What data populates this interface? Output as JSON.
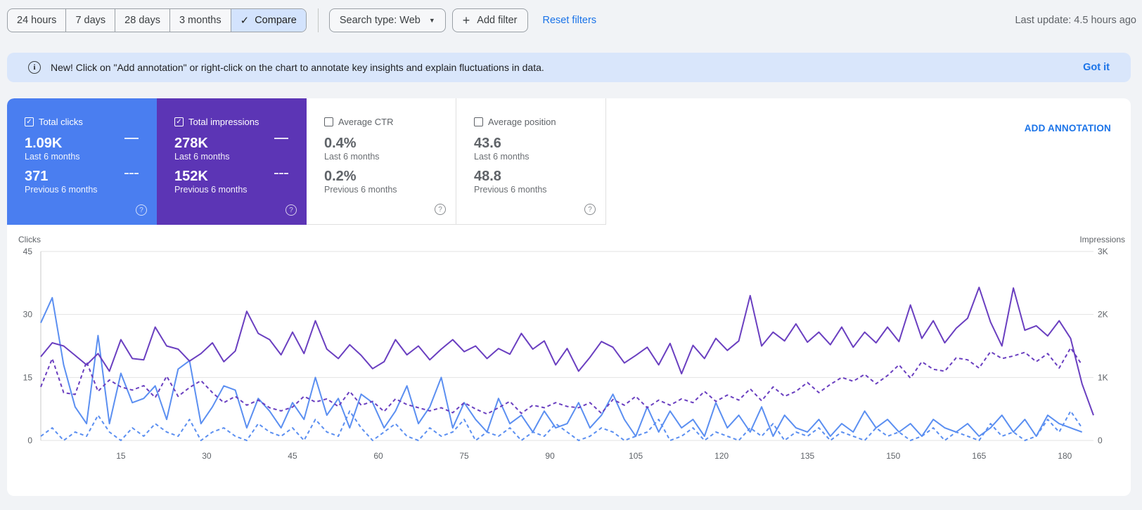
{
  "toolbar": {
    "ranges": [
      "24 hours",
      "7 days",
      "28 days",
      "3 months"
    ],
    "compare_label": "Compare",
    "search_type_label": "Search type: Web",
    "add_filter_label": "Add filter",
    "reset_filters_label": "Reset filters",
    "last_update": "Last update: 4.5 hours ago"
  },
  "banner": {
    "text": "New! Click on \"Add annotation\" or right-click on the chart to annotate key insights and explain fluctuations in data.",
    "action": "Got it"
  },
  "metrics": [
    {
      "label": "Total clicks",
      "checked": true,
      "current": "1.09K",
      "current_period": "Last 6 months",
      "previous": "371",
      "previous_period": "Previous 6 months",
      "color": "#4a7ef0"
    },
    {
      "label": "Total impressions",
      "checked": true,
      "current": "278K",
      "current_period": "Last 6 months",
      "previous": "152K",
      "previous_period": "Previous 6 months",
      "color": "#5c35b5"
    },
    {
      "label": "Average CTR",
      "checked": false,
      "current": "0.4%",
      "current_period": "Last 6 months",
      "previous": "0.2%",
      "previous_period": "Previous 6 months"
    },
    {
      "label": "Average position",
      "checked": false,
      "current": "43.6",
      "current_period": "Last 6 months",
      "previous": "48.8",
      "previous_period": "Previous 6 months"
    }
  ],
  "add_annotation_label": "ADD ANNOTATION",
  "chart_data": {
    "type": "line",
    "left_axis": {
      "label": "Clicks",
      "ticks": [
        0,
        15,
        30,
        45
      ],
      "ylim": [
        0,
        45
      ]
    },
    "right_axis": {
      "label": "Impressions",
      "ticks": [
        "0",
        "1K",
        "2K",
        "3K"
      ],
      "ylim": [
        0,
        3000
      ]
    },
    "x_ticks": [
      15,
      30,
      45,
      60,
      75,
      90,
      105,
      120,
      135,
      150,
      165,
      180
    ],
    "xlim": [
      1,
      185
    ],
    "grid": true,
    "series": [
      {
        "name": "Total clicks",
        "period": "Last 6 months",
        "axis": "left",
        "style": "solid",
        "color": "#5b8ff1",
        "x": [
          1,
          3,
          5,
          7,
          9,
          11,
          13,
          15,
          17,
          19,
          21,
          23,
          25,
          27,
          29,
          31,
          33,
          35,
          37,
          39,
          41,
          43,
          45,
          47,
          49,
          51,
          53,
          55,
          57,
          59,
          61,
          63,
          65,
          67,
          69,
          71,
          73,
          75,
          77,
          79,
          81,
          83,
          85,
          87,
          89,
          91,
          93,
          95,
          97,
          99,
          101,
          103,
          105,
          107,
          109,
          111,
          113,
          115,
          117,
          119,
          121,
          123,
          125,
          127,
          129,
          131,
          133,
          135,
          137,
          139,
          141,
          143,
          145,
          147,
          149,
          151,
          153,
          155,
          157,
          159,
          161,
          163,
          165,
          167,
          169,
          171,
          173,
          175,
          177,
          179,
          181,
          183
        ],
        "values": [
          28,
          34,
          18,
          8,
          4,
          25,
          4,
          16,
          9,
          10,
          13,
          5,
          17,
          19,
          4,
          8,
          13,
          12,
          3,
          10,
          7,
          3,
          9,
          5,
          15,
          6,
          10,
          3,
          11,
          9,
          3,
          7,
          13,
          4,
          8,
          15,
          3,
          9,
          5,
          2,
          10,
          4,
          6,
          2,
          7,
          3,
          4,
          9,
          3,
          6,
          11,
          5,
          1,
          8,
          2,
          7,
          3,
          5,
          1,
          9,
          3,
          6,
          2,
          8,
          1,
          6,
          3,
          2,
          5,
          1,
          4,
          2,
          7,
          3,
          5,
          2,
          4,
          1,
          5,
          3,
          2,
          4,
          1,
          3,
          6,
          2,
          5,
          1,
          6,
          4,
          3,
          2
        ]
      },
      {
        "name": "Total clicks",
        "period": "Previous 6 months",
        "axis": "left",
        "style": "dashed",
        "color": "#5b8ff1",
        "x": [
          1,
          3,
          5,
          7,
          9,
          11,
          13,
          15,
          17,
          19,
          21,
          23,
          25,
          27,
          29,
          31,
          33,
          35,
          37,
          39,
          41,
          43,
          45,
          47,
          49,
          51,
          53,
          55,
          57,
          59,
          61,
          63,
          65,
          67,
          69,
          71,
          73,
          75,
          77,
          79,
          81,
          83,
          85,
          87,
          89,
          91,
          93,
          95,
          97,
          99,
          101,
          103,
          105,
          107,
          109,
          111,
          113,
          115,
          117,
          119,
          121,
          123,
          125,
          127,
          129,
          131,
          133,
          135,
          137,
          139,
          141,
          143,
          145,
          147,
          149,
          151,
          153,
          155,
          157,
          159,
          161,
          163,
          165,
          167,
          169,
          171,
          173,
          175,
          177,
          179,
          181,
          183
        ],
        "values": [
          1,
          3,
          0,
          2,
          1,
          6,
          2,
          0,
          3,
          1,
          4,
          2,
          1,
          5,
          0,
          2,
          3,
          1,
          0,
          4,
          2,
          1,
          3,
          0,
          5,
          2,
          1,
          7,
          3,
          0,
          2,
          4,
          1,
          0,
          3,
          1,
          2,
          5,
          0,
          2,
          1,
          3,
          0,
          2,
          1,
          4,
          2,
          0,
          1,
          3,
          2,
          0,
          1,
          2,
          5,
          0,
          1,
          3,
          0,
          2,
          1,
          0,
          3,
          1,
          4,
          0,
          2,
          1,
          3,
          0,
          2,
          1,
          0,
          3,
          1,
          2,
          0,
          1,
          3,
          0,
          2,
          1,
          0,
          4,
          1,
          2,
          0,
          1,
          5,
          2,
          7,
          3
        ]
      },
      {
        "name": "Total impressions",
        "period": "Last 6 months",
        "axis": "right",
        "style": "solid",
        "color": "#6a3fc0",
        "x": [
          1,
          3,
          5,
          7,
          9,
          11,
          13,
          15,
          17,
          19,
          21,
          23,
          25,
          27,
          29,
          31,
          33,
          35,
          37,
          39,
          41,
          43,
          45,
          47,
          49,
          51,
          53,
          55,
          57,
          59,
          61,
          63,
          65,
          67,
          69,
          71,
          73,
          75,
          77,
          79,
          81,
          83,
          85,
          87,
          89,
          91,
          93,
          95,
          97,
          99,
          101,
          103,
          105,
          107,
          109,
          111,
          113,
          115,
          117,
          119,
          121,
          123,
          125,
          127,
          129,
          131,
          133,
          135,
          137,
          139,
          141,
          143,
          145,
          147,
          149,
          151,
          153,
          155,
          157,
          159,
          161,
          163,
          165,
          167,
          169,
          171,
          173,
          175,
          177,
          179,
          181,
          183,
          185
        ],
        "values": [
          1330,
          1550,
          1500,
          1350,
          1200,
          1380,
          1100,
          1600,
          1300,
          1280,
          1800,
          1500,
          1450,
          1260,
          1380,
          1550,
          1250,
          1420,
          2050,
          1700,
          1600,
          1360,
          1720,
          1380,
          1900,
          1450,
          1300,
          1520,
          1350,
          1140,
          1250,
          1600,
          1360,
          1500,
          1280,
          1450,
          1600,
          1410,
          1500,
          1300,
          1460,
          1370,
          1700,
          1450,
          1580,
          1200,
          1460,
          1100,
          1320,
          1570,
          1480,
          1230,
          1350,
          1480,
          1200,
          1540,
          1060,
          1510,
          1300,
          1620,
          1430,
          1580,
          2300,
          1500,
          1720,
          1580,
          1850,
          1560,
          1720,
          1520,
          1800,
          1480,
          1720,
          1550,
          1800,
          1570,
          2150,
          1620,
          1900,
          1550,
          1780,
          1940,
          2430,
          1880,
          1500,
          2420,
          1750,
          1820,
          1660,
          1900,
          1620,
          900,
          400
        ]
      },
      {
        "name": "Total impressions",
        "period": "Previous 6 months",
        "axis": "right",
        "style": "dashed",
        "color": "#6a3fc0",
        "x": [
          1,
          3,
          5,
          7,
          9,
          11,
          13,
          15,
          17,
          19,
          21,
          23,
          25,
          27,
          29,
          31,
          33,
          35,
          37,
          39,
          41,
          43,
          45,
          47,
          49,
          51,
          53,
          55,
          57,
          59,
          61,
          63,
          65,
          67,
          69,
          71,
          73,
          75,
          77,
          79,
          81,
          83,
          85,
          87,
          89,
          91,
          93,
          95,
          97,
          99,
          101,
          103,
          105,
          107,
          109,
          111,
          113,
          115,
          117,
          119,
          121,
          123,
          125,
          127,
          129,
          131,
          133,
          135,
          137,
          139,
          141,
          143,
          145,
          147,
          149,
          151,
          153,
          155,
          157,
          159,
          161,
          163,
          165,
          167,
          169,
          171,
          173,
          175,
          177,
          179,
          181,
          183
        ],
        "values": [
          850,
          1300,
          760,
          730,
          1250,
          780,
          960,
          850,
          800,
          870,
          680,
          1020,
          700,
          840,
          950,
          760,
          600,
          700,
          560,
          640,
          520,
          470,
          530,
          700,
          610,
          660,
          540,
          780,
          560,
          620,
          460,
          660,
          570,
          520,
          470,
          520,
          440,
          600,
          500,
          420,
          520,
          620,
          430,
          560,
          520,
          600,
          540,
          520,
          600,
          430,
          650,
          560,
          700,
          520,
          640,
          560,
          660,
          600,
          780,
          620,
          720,
          640,
          820,
          630,
          850,
          700,
          780,
          920,
          760,
          890,
          1000,
          940,
          1050,
          900,
          1030,
          1200,
          990,
          1250,
          1130,
          1100,
          1310,
          1280,
          1150,
          1410,
          1300,
          1340,
          1400,
          1250,
          1380,
          1150,
          1470,
          1200
        ]
      }
    ]
  }
}
